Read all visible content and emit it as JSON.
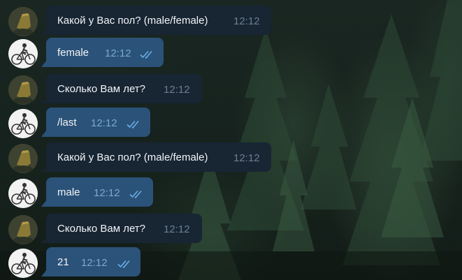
{
  "messages": [
    {
      "from": "bot",
      "text": "Какой у Вас пол? (male/female)",
      "time": "12:12"
    },
    {
      "from": "user",
      "text": "female",
      "time": "12:12",
      "read": true
    },
    {
      "from": "bot",
      "text": "Сколько Вам лет?",
      "time": "12:12"
    },
    {
      "from": "user",
      "text": "/last",
      "time": "12:12",
      "read": true
    },
    {
      "from": "bot",
      "text": "Какой у Вас пол? (male/female)",
      "time": "12:12"
    },
    {
      "from": "user",
      "text": "male",
      "time": "12:12",
      "read": true
    },
    {
      "from": "bot",
      "text": "Сколько Вам лет?",
      "time": "12:12"
    },
    {
      "from": "user",
      "text": "21",
      "time": "12:12",
      "read": true
    }
  ],
  "colors": {
    "incoming_bubble": "#182533",
    "outgoing_bubble": "#2b5278",
    "read_ticks": "#68aee8"
  },
  "icons": {
    "read_status": "double-check-icon",
    "bot_avatar": "bot-avatar",
    "user_avatar": "cyclist-avatar"
  }
}
